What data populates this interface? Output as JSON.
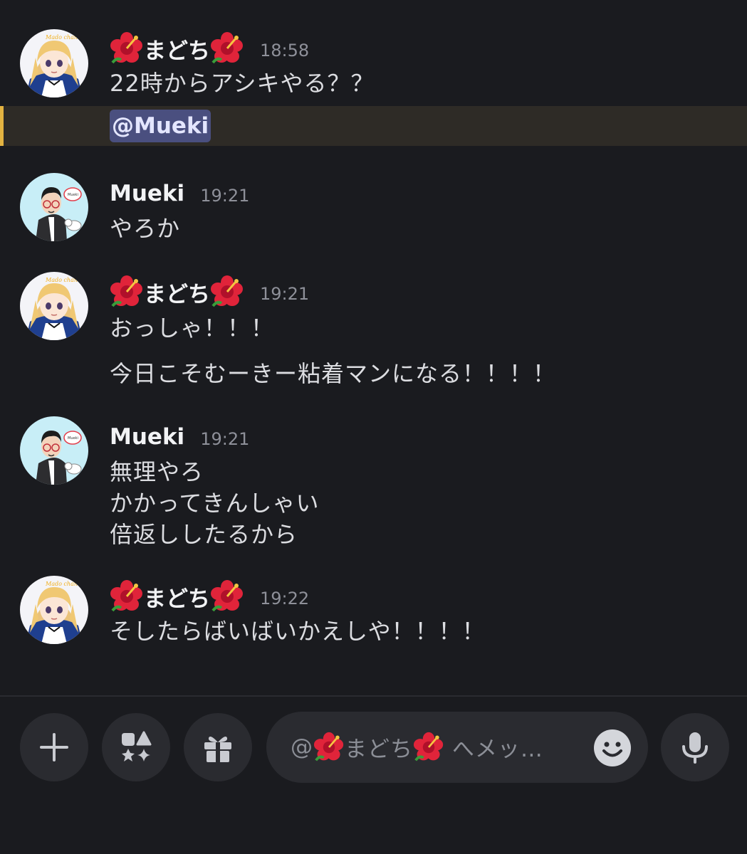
{
  "messages": [
    {
      "username": "まどち",
      "time": "18:58",
      "lines": [
        "22時からアシキやる？？"
      ],
      "mention": "@Mueki"
    },
    {
      "username": "Mueki",
      "time": "19:21",
      "lines": [
        "やろか"
      ]
    },
    {
      "username": "まどち",
      "time": "19:21",
      "lines": [
        "おっしゃ！！！",
        "今日こそむーきー粘着マンになる！！！！"
      ]
    },
    {
      "username": "Mueki",
      "time": "19:21",
      "lines": [
        "無理やろ",
        "かかってきんしゃい",
        "倍返ししたるから"
      ]
    },
    {
      "username": "まどち",
      "time": "19:22",
      "lines": [
        "そしたらばいばいかえしや！！！！"
      ]
    }
  ],
  "composer": {
    "placeholder_prefix": "@",
    "placeholder_name": "まどち",
    "placeholder_suffix": " へメッ…"
  },
  "icons": {
    "username_decoration": "hibiscus-emoji",
    "add": "plus-icon",
    "apps": "apps-icon",
    "gift": "gift-icon",
    "emoji": "emoji-smile-icon",
    "voice": "microphone-icon"
  },
  "colors": {
    "background": "#1a1b1f",
    "mention_highlight": "#2e2b26",
    "mention_bar": "#e3b341",
    "mention_pill": "#4a4f7f",
    "button_bg": "#2a2b30"
  }
}
